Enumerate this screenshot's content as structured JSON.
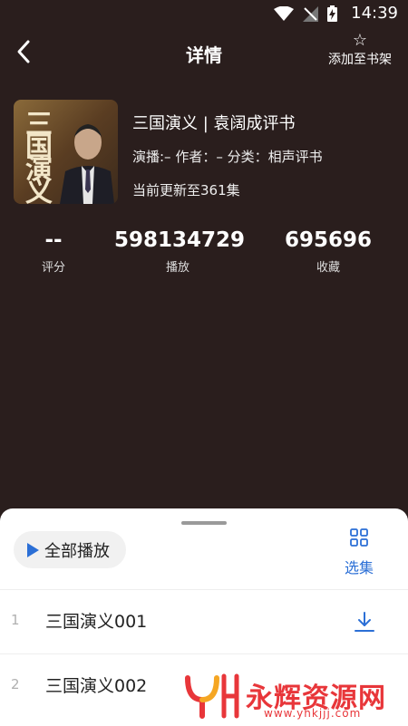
{
  "status_bar": {
    "time": "14:39"
  },
  "header": {
    "title": "详情",
    "add_to_shelf_label": "添加至书架"
  },
  "book": {
    "cover_text": [
      "三",
      "国",
      "演",
      "义"
    ],
    "title": "三国演义 | 袁阔成评书",
    "meta": "演播:–  作者：–  分类：相声评书",
    "update_status": "当前更新至361集"
  },
  "stats": [
    {
      "value": "--",
      "label": "评分"
    },
    {
      "value": "598134729",
      "label": "播放"
    },
    {
      "value": "695696",
      "label": "收藏"
    }
  ],
  "sheet": {
    "play_all_label": "全部播放",
    "select_episodes_label": "选集",
    "episodes": [
      {
        "index": "1",
        "name": "三国演义001"
      },
      {
        "index": "2",
        "name": "三国演义002"
      }
    ]
  },
  "watermark": {
    "text": "永辉资源网",
    "url": "www.yhkjjj.com"
  },
  "colors": {
    "background": "#2a1e1d",
    "accent": "#2b6fd6",
    "watermark": "#e8363a"
  }
}
